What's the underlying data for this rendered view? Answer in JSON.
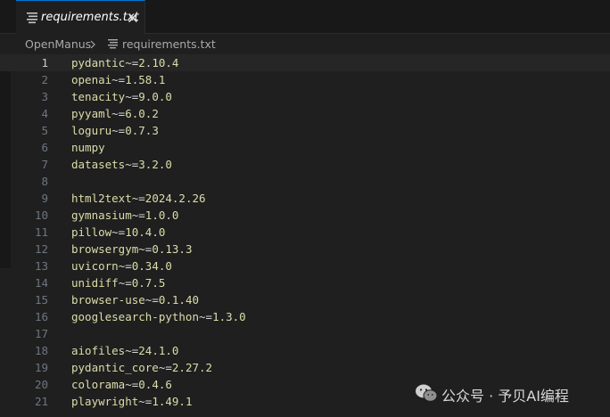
{
  "tab": {
    "label": "requirements.txt",
    "file_icon": "lines-file-icon",
    "close_icon": "close-icon"
  },
  "breadcrumb": {
    "folder": "OpenManus",
    "separator_icon": "chevron-right-icon",
    "file_icon": "lines-file-icon",
    "file": "requirements.txt"
  },
  "editor": {
    "current_line": 1,
    "lines": [
      {
        "num": "1",
        "pkg": "pydantic",
        "op": "~=",
        "ver": "2.10.4"
      },
      {
        "num": "2",
        "pkg": "openai",
        "op": "~=",
        "ver": "1.58.1"
      },
      {
        "num": "3",
        "pkg": "tenacity",
        "op": "~=",
        "ver": "9.0.0"
      },
      {
        "num": "4",
        "pkg": "pyyaml",
        "op": "~=",
        "ver": "6.0.2"
      },
      {
        "num": "5",
        "pkg": "loguru",
        "op": "~=",
        "ver": "0.7.3"
      },
      {
        "num": "6",
        "pkg": "numpy",
        "op": "",
        "ver": ""
      },
      {
        "num": "7",
        "pkg": "datasets",
        "op": "~=",
        "ver": "3.2.0"
      },
      {
        "num": "8",
        "pkg": "",
        "op": "",
        "ver": ""
      },
      {
        "num": "9",
        "pkg": "html2text",
        "op": "~=",
        "ver": "2024.2.26"
      },
      {
        "num": "10",
        "pkg": "gymnasium",
        "op": "~=",
        "ver": "1.0.0"
      },
      {
        "num": "11",
        "pkg": "pillow",
        "op": "~=",
        "ver": "10.4.0"
      },
      {
        "num": "12",
        "pkg": "browsergym",
        "op": "~=",
        "ver": "0.13.3"
      },
      {
        "num": "13",
        "pkg": "uvicorn",
        "op": "~=",
        "ver": "0.34.0"
      },
      {
        "num": "14",
        "pkg": "unidiff",
        "op": "~=",
        "ver": "0.7.5"
      },
      {
        "num": "15",
        "pkg": "browser-use",
        "op": "~=",
        "ver": "0.1.40"
      },
      {
        "num": "16",
        "pkg": "googlesearch-python",
        "op": "~=",
        "ver": "1.3.0"
      },
      {
        "num": "17",
        "pkg": "",
        "op": "",
        "ver": ""
      },
      {
        "num": "18",
        "pkg": "aiofiles",
        "op": "~=",
        "ver": "24.1.0"
      },
      {
        "num": "19",
        "pkg": "pydantic_core",
        "op": "~=",
        "ver": "2.27.2"
      },
      {
        "num": "20",
        "pkg": "colorama",
        "op": "~=",
        "ver": "0.4.6"
      },
      {
        "num": "21",
        "pkg": "playwright",
        "op": "~=",
        "ver": "1.49.1"
      }
    ]
  },
  "watermark": {
    "logo": "wechat-logo-icon",
    "text": "公众号 · 予贝AI编程"
  },
  "colors": {
    "background": "#1f1f1f",
    "tab_bar": "#181818",
    "package": "#dcdcaa",
    "operator": "#d4d4d4",
    "line_number": "#6e7681",
    "active_line_number": "#cccccc",
    "current_line_highlight": "#262626"
  }
}
